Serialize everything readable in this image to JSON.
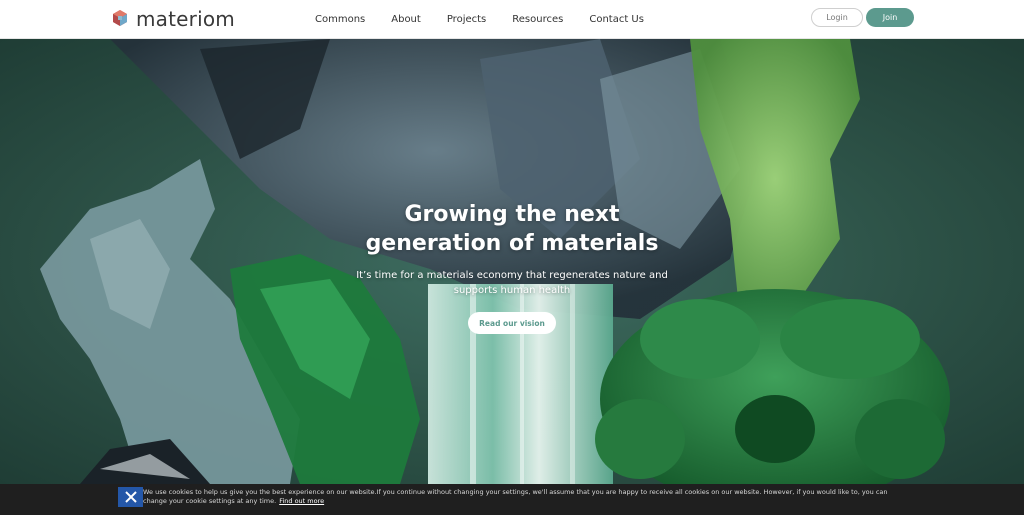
{
  "header": {
    "logo_text": "materiom",
    "nav": [
      "Commons",
      "About",
      "Projects",
      "Resources",
      "Contact Us"
    ],
    "login_label": "Login",
    "join_label": "Join"
  },
  "hero": {
    "title_line1": "Growing the next",
    "title_line2": "generation of materials",
    "subtitle_line1": "It’s time for a materials economy that regenerates nature and",
    "subtitle_line2": "supports human health",
    "cta_label": "Read our vision"
  },
  "cookie": {
    "text": "We use cookies to help us give you the best experience on our website.If you continue without changing your settings, we'll assume that you are happy to receive all cookies on our website. However, if you would like to, you can change your cookie settings at any time.",
    "link_label": "Find out more"
  },
  "colors": {
    "accent": "#5c9a8e",
    "cookie_close": "#2457a8"
  }
}
